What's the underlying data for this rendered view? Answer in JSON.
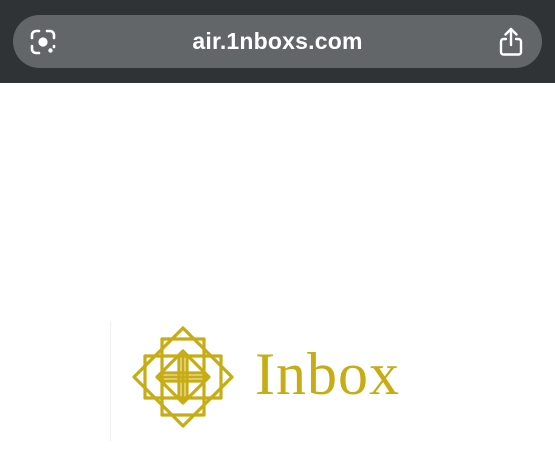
{
  "browser": {
    "url": "air.1nboxs.com",
    "icons": {
      "lens": "lens-scan-icon",
      "share": "share-icon"
    }
  },
  "logo": {
    "wordmark": "Inbox",
    "mark_icon": "ornamental-diamond-flower-icon",
    "color": "#c8ac14"
  },
  "colors": {
    "toolbar": "#2f3335",
    "address_pill": "#626668",
    "page_background": "#ffffff"
  }
}
